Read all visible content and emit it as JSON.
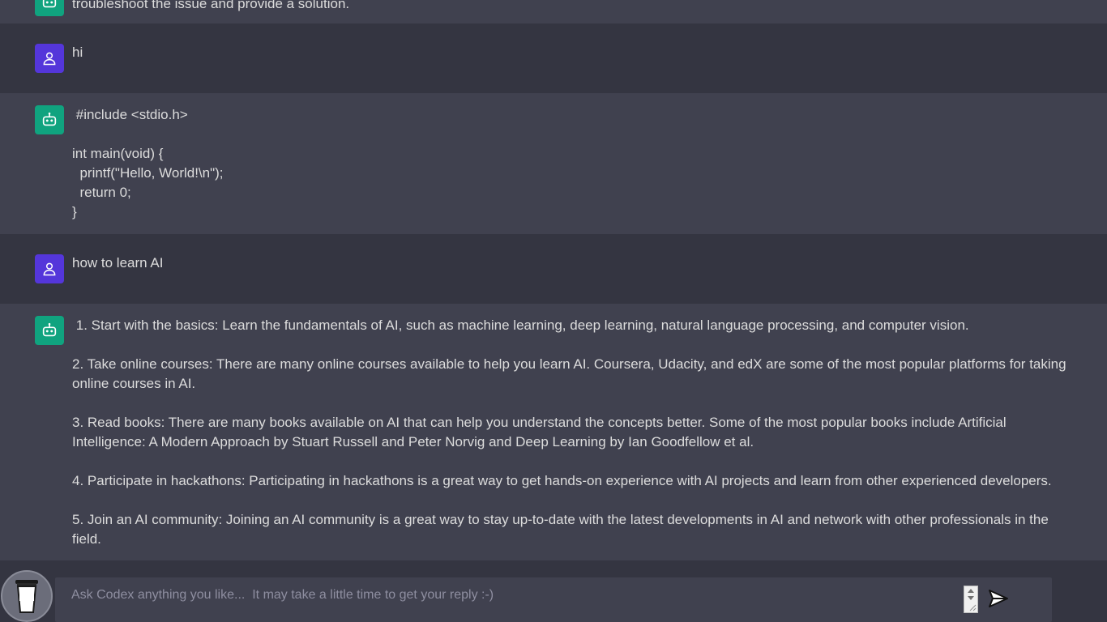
{
  "messages": {
    "partial_bot": "troubleshoot the issue and provide a solution.",
    "user1": "hi",
    "bot1": " #include <stdio.h>\n\nint main(void) {\n  printf(\"Hello, World!\\n\");\n  return 0;\n}",
    "user2": "how to learn AI",
    "bot2": " 1. Start with the basics: Learn the fundamentals of AI, such as machine learning, deep learning, natural language processing, and computer vision.\n\n2. Take online courses: There are many online courses available to help you learn AI. Coursera, Udacity, and edX are some of the most popular platforms for taking online courses in AI.\n\n3. Read books: There are many books available on AI that can help you understand the concepts better. Some of the most popular books include Artificial Intelligence: A Modern Approach by Stuart Russell and Peter Norvig and Deep Learning by Ian Goodfellow et al.\n\n4. Participate in hackathons: Participating in hackathons is a great way to get hands-on experience with AI projects and learn from other experienced developers.\n\n5. Join an AI community: Joining an AI community is a great way to stay up-to-date with the latest developments in AI and network with other professionals in the field."
  },
  "composer": {
    "placeholder": "Ask Codex anything you like...  It may take a little time to get your reply :-)",
    "value": ""
  },
  "icons": {
    "user_avatar": "user-icon",
    "bot_avatar": "robot-icon",
    "send": "send-icon",
    "coffee": "coffee-cup-icon"
  },
  "colors": {
    "background": "#343541",
    "bot_row": "#40414f",
    "user_avatar": "#5436da",
    "bot_avatar": "#10a37f"
  }
}
